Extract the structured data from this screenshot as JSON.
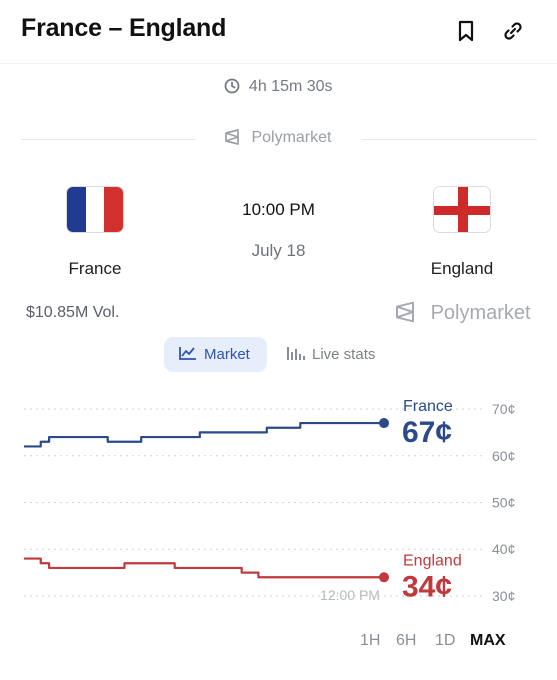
{
  "header": {
    "title": "France – England",
    "bookmark_icon": "bookmark-icon",
    "link_icon": "link-icon"
  },
  "countdown": {
    "icon": "clock-icon",
    "text": "4h 15m 30s"
  },
  "source": {
    "name": "Polymarket",
    "icon": "polymarket-logo-icon"
  },
  "match": {
    "time": "10:00 PM",
    "date": "July 18",
    "home": {
      "name": "France",
      "flag_colors": [
        "#1f3b8f",
        "#ffffff",
        "#d2302f"
      ]
    },
    "away": {
      "name": "England",
      "flag_colors": [
        "#ffffff",
        "#cf2a2a"
      ]
    },
    "volume": "$10.85M Vol."
  },
  "tabs": {
    "market_label": "Market",
    "market_icon": "line-chart-icon",
    "live_label": "Live stats",
    "live_icon": "bar-chart-icon",
    "active": "Market"
  },
  "chart_data": {
    "type": "line",
    "y_unit": "¢",
    "ylim": [
      27,
      73
    ],
    "y_ticks": [
      "70¢",
      "60¢",
      "50¢",
      "40¢",
      "30¢"
    ],
    "y_tick_values": [
      70,
      60,
      50,
      40,
      30
    ],
    "x_label": "12:00 PM",
    "grid": true,
    "series": [
      {
        "name": "France",
        "color": "#2b4a8b",
        "current_label": "67¢",
        "values": [
          62,
          62,
          63,
          64,
          64,
          64,
          64,
          64,
          64,
          64,
          63,
          63,
          63,
          63,
          64,
          64,
          64,
          64,
          64,
          64,
          64,
          65,
          65,
          65,
          65,
          65,
          65,
          65,
          65,
          66,
          66,
          66,
          66,
          67,
          67,
          67,
          67,
          67,
          67,
          67,
          67,
          67,
          67,
          67
        ]
      },
      {
        "name": "England",
        "color": "#c0393b",
        "current_label": "34¢",
        "values": [
          38,
          38,
          37,
          36,
          36,
          36,
          36,
          36,
          36,
          36,
          36,
          36,
          37,
          37,
          37,
          37,
          37,
          37,
          36,
          36,
          36,
          36,
          36,
          36,
          36,
          36,
          35,
          35,
          34,
          34,
          34,
          34,
          34,
          34,
          34,
          34,
          34,
          34,
          34,
          34,
          34,
          34,
          34,
          34
        ]
      }
    ]
  },
  "ranges": [
    "1H",
    "6H",
    "1D",
    "MAX"
  ],
  "active_range": "MAX"
}
